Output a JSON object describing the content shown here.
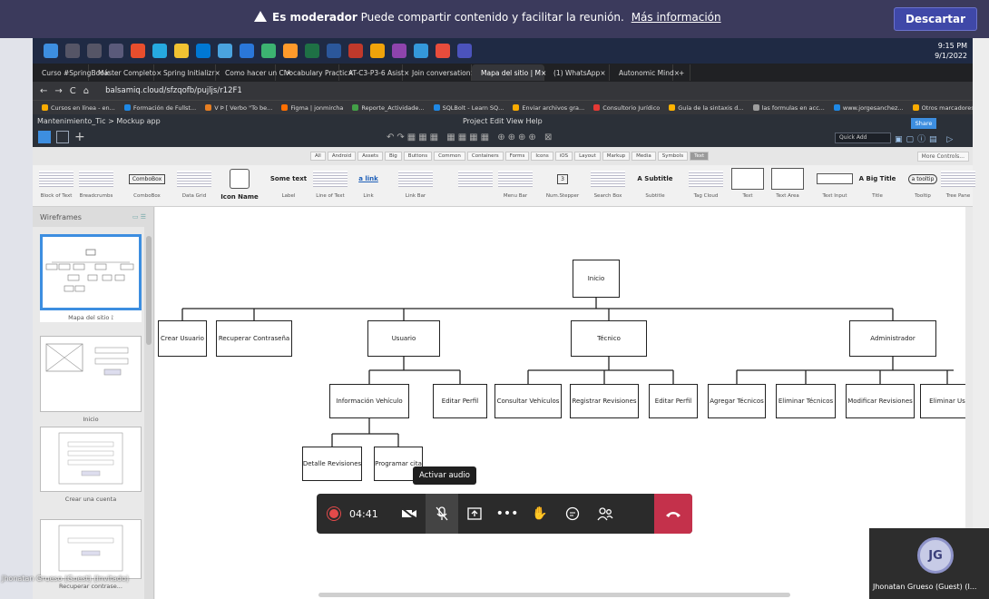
{
  "banner": {
    "moderator_bold": "Es moderador",
    "moderator_text": "Puede compartir contenido y facilitar la reunión.",
    "link": "Más información",
    "discard": "Descartar"
  },
  "taskbar": {
    "time": "9:15 PM",
    "date": "9/1/2022"
  },
  "tabs": [
    {
      "label": "Curso #SpringBoo",
      "color": "#e53935"
    },
    {
      "label": "Máster Completo",
      "color": "#7e57c2"
    },
    {
      "label": "Spring Initializr",
      "color": "#6db33f"
    },
    {
      "label": "Como hacer un CI",
      "color": "#e53935"
    },
    {
      "label": "Vocabulary Practic",
      "color": "#1e88e5"
    },
    {
      "label": "AT-C3-P3-6 Asist",
      "color": "#1e88e5"
    },
    {
      "label": "Join conversation",
      "color": "#5b5fc7"
    },
    {
      "label": "Mapa del sitio | M",
      "color": "#e8eaed"
    },
    {
      "label": "(1) WhatsApp",
      "color": "#25d366"
    },
    {
      "label": "Autonomic Mind",
      "color": "#8d6e63"
    }
  ],
  "address": {
    "url": "balsamiq.cloud/sfzqofb/pujljs/r12F1"
  },
  "bookmarks": [
    "Cursos en línea - en...",
    "Formación de Fullst...",
    "V Þ [ Verbo \"To be...",
    "Figma | jonmircha",
    "Reporte_Actividade...",
    "SQLBolt - Learn SQ...",
    "Enviar archivos gra...",
    "Consultorio Jurídico",
    "Guía de la sintaxis d...",
    "las formulas en acc...",
    "www.jorgesanchez...",
    "Otros marcadores"
  ],
  "app": {
    "breadcrumb": "Mantenimiento_Tic > Mockup app",
    "menu": "Project  Edit  View  Help",
    "quick_add": "Quick Add",
    "share": "Share"
  },
  "library_tabs": [
    "All",
    "Android",
    "Assets",
    "Big",
    "Buttons",
    "Common",
    "Containers",
    "Forms",
    "Icons",
    "iOS",
    "Layout",
    "Markup",
    "Media",
    "Symbols",
    "Text"
  ],
  "library_active": "Text",
  "more_controls": "More Controls...",
  "components": [
    {
      "name": "Block of Text",
      "sample": ""
    },
    {
      "name": "Breadcrumbs",
      "sample": ""
    },
    {
      "name": "ComboBox",
      "sample": "ComboBox"
    },
    {
      "name": "Data Grid",
      "sample": ""
    },
    {
      "name": "Icon Name",
      "sample": ""
    },
    {
      "name": "Label",
      "sample": "Some text"
    },
    {
      "name": "Line of Text",
      "sample": ""
    },
    {
      "name": "Link",
      "sample": "a link"
    },
    {
      "name": "Link Bar",
      "sample": ""
    },
    {
      "name": "",
      "sample": ""
    },
    {
      "name": "Menu Bar",
      "sample": ""
    },
    {
      "name": "Num.Stepper",
      "sample": "3"
    },
    {
      "name": "Search Box",
      "sample": ""
    },
    {
      "name": "Subtitle",
      "sample": "A Subtitle"
    },
    {
      "name": "Tag Cloud",
      "sample": ""
    },
    {
      "name": "Text",
      "sample": ""
    },
    {
      "name": "Text Area",
      "sample": ""
    },
    {
      "name": "Text Input",
      "sample": ""
    },
    {
      "name": "Title",
      "sample": "A Big Title"
    },
    {
      "name": "Tooltip",
      "sample": "a tooltip"
    },
    {
      "name": "Tree Pane",
      "sample": ""
    }
  ],
  "wireframes": {
    "title": "Wireframes",
    "items": [
      "Mapa del sitio",
      "Inicio",
      "Crear una cuenta",
      "Recuperar contrase..."
    ]
  },
  "sitemap": {
    "root": "Inicio",
    "level1": [
      "Crear Usuario",
      "Recuperar Contraseña",
      "Usuario",
      "Técnico",
      "Administrador"
    ],
    "usuario_children": [
      "Información Vehículo",
      "Editar Perfil"
    ],
    "vehiculo_children": [
      "Detalle Revisiones",
      "Programar cita"
    ],
    "tecnico_children": [
      "Consultar Vehículos",
      "Registrar Revisiones",
      "Editar Perfil"
    ],
    "admin_children": [
      "Agregar Técnicos",
      "Eliminar Técnicos",
      "Modificar Revisiones",
      "Eliminar Us"
    ]
  },
  "meeting": {
    "tooltip": "Activar audio",
    "timer": "04:41"
  },
  "participant": {
    "initials": "JG",
    "name": "Jhonatan Grueso (Guest) (I...",
    "overlay_label": "Jhonatan Grueso (Guest) (Invitado)"
  },
  "colors": {
    "accent": "#3d8ee0",
    "banner": "#3b3a5c",
    "hangup": "#c4314b"
  }
}
